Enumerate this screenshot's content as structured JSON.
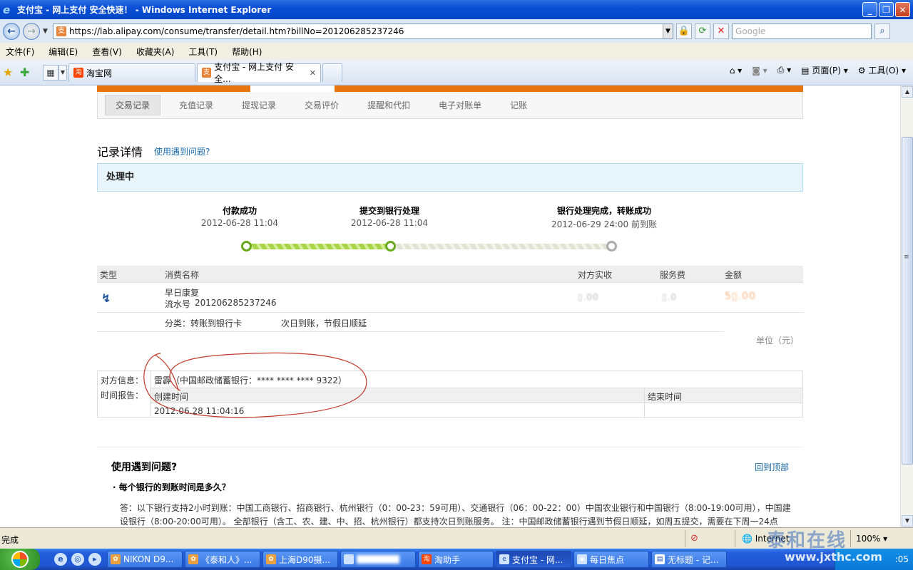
{
  "window": {
    "title": "支付宝 - 网上支付 安全快速！ - Windows Internet Explorer"
  },
  "address": {
    "url": "https://lab.alipay.com/consume/transfer/detail.htm?billNo=201206285237246",
    "search_placeholder": "Google"
  },
  "menu": [
    "文件(F)",
    "编辑(E)",
    "查看(V)",
    "收藏夹(A)",
    "工具(T)",
    "帮助(H)"
  ],
  "tabs": [
    {
      "label": "淘宝网",
      "active": false
    },
    {
      "label": "支付宝 - 网上支付 安全...",
      "active": true
    }
  ],
  "tab_tools": {
    "page": "页面(P)",
    "tools": "工具(O)"
  },
  "subnav": [
    "交易记录",
    "充值记录",
    "提现记录",
    "交易评价",
    "提醒和代扣",
    "电子对账单",
    "记账"
  ],
  "record": {
    "title": "记录详情",
    "help_link": "使用遇到问题?",
    "status": "处理中"
  },
  "steps": [
    {
      "name": "付款成功",
      "date": "2012-06-28 11:04"
    },
    {
      "name": "提交到银行处理",
      "date": "2012-06-28 11:04"
    },
    {
      "name": "银行处理完成，转账成功",
      "date": "2012-06-29 24:00 前到账"
    }
  ],
  "progress": {
    "completed_steps": 2,
    "total_steps": 3
  },
  "table": {
    "headers": [
      "类型",
      "消费名称",
      "对方实收",
      "服务费",
      "金额"
    ],
    "row": {
      "name": "早日康复",
      "serial_label": "流水号",
      "serial": "201206285237246",
      "received": "▯.00",
      "fee": "▯.0",
      "amount": "5▯.00"
    },
    "category": "分类：转账到银行卡",
    "arrival": "次日到账，节假日顺延",
    "unit": "单位（元）"
  },
  "info": {
    "counterparty_label": "对方信息：",
    "counterparty": "雷霹（中国邮政储蓄银行：**** **** **** 9322）",
    "time_label": "时间报告：",
    "created_label": "创建时间",
    "ended_label": "结束时间",
    "created": "2012.06.28 11:04:16",
    "ended": ""
  },
  "faq": {
    "title": "使用遇到问题?",
    "back_top": "回到顶部",
    "question": "· 每个银行的到账时间是多久？",
    "answer": "答：以下银行支持2小时到账：中国工商银行、招商银行、杭州银行（0：00-23：59可用）、交通银行（06：00-22：00）中国农业银行和中国银行（8:00-19:00可用），中国建设银行（8:00-20:00可用）。 全部银行（含工、农、建、中、招、杭州银行）都支持次日到账服务。 注：中国邮政储蓄银行遇到节假日顺延，如周五提交，需要在下周一24点"
  },
  "statusbar": {
    "text": "完成",
    "zone": "Internet",
    "zoom": "100%"
  },
  "taskbar": [
    {
      "label": "NIKON D9...",
      "active": false
    },
    {
      "label": "《泰和人》...",
      "active": false
    },
    {
      "label": "上海D90摄...",
      "active": false
    },
    {
      "label": "",
      "active": false
    },
    {
      "label": "淘助手",
      "active": false
    },
    {
      "label": "支付宝 - 网...",
      "active": true
    },
    {
      "label": "每日焦点",
      "active": false
    },
    {
      "label": "无标题 - 记...",
      "active": false
    }
  ],
  "tray_time": ":05",
  "watermark": {
    "line1": "泰和在线",
    "line2": "www.jxthc.com"
  }
}
